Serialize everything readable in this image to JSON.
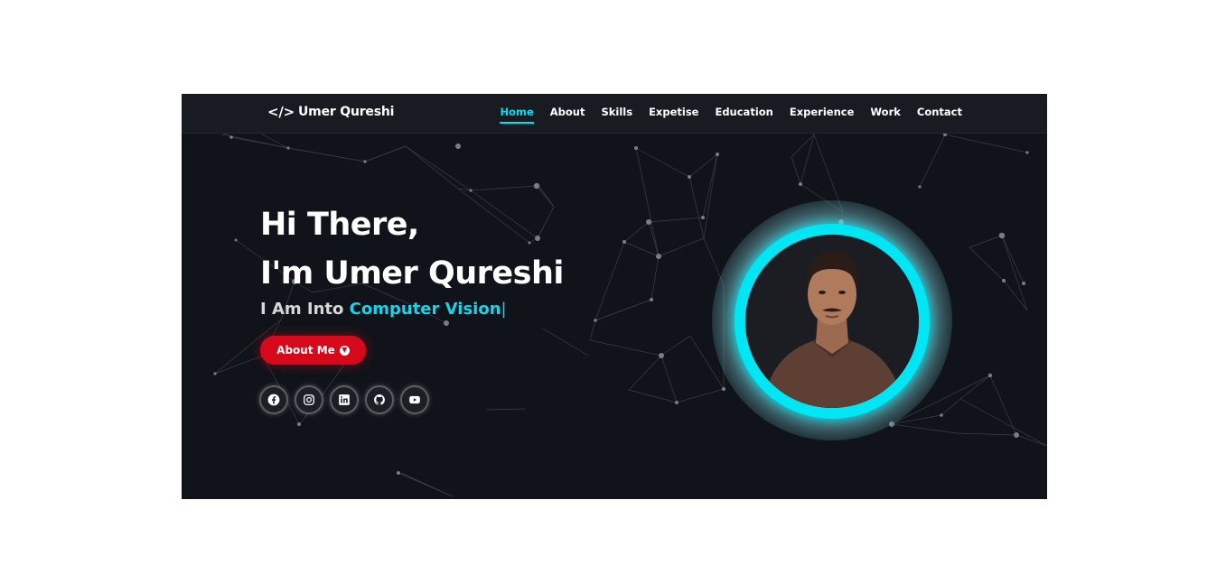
{
  "brand": {
    "logo_text": "Umer Qureshi",
    "logo_icon": "code-icon"
  },
  "nav": {
    "items": [
      {
        "label": "Home",
        "active": true
      },
      {
        "label": "About"
      },
      {
        "label": "Skills"
      },
      {
        "label": "Expetise"
      },
      {
        "label": "Education"
      },
      {
        "label": "Experience"
      },
      {
        "label": "Work"
      },
      {
        "label": "Contact"
      }
    ]
  },
  "hero": {
    "line1": "Hi There,",
    "line2": "I'm Umer Qureshi",
    "typing_prefix": "I Am Into ",
    "typing_highlight": "Computer Vision",
    "typing_cursor": "|",
    "cta_label": "About Me"
  },
  "socials": [
    {
      "icon": "facebook-icon"
    },
    {
      "icon": "instagram-icon"
    },
    {
      "icon": "linkedin-icon"
    },
    {
      "icon": "github-icon"
    },
    {
      "icon": "youtube-icon"
    }
  ],
  "colors": {
    "background": "#11131a",
    "navbar": "#181b22",
    "accent": "#00e0f0",
    "cta": "#d6091b"
  },
  "avatar": {
    "alt": "profile-photo"
  }
}
